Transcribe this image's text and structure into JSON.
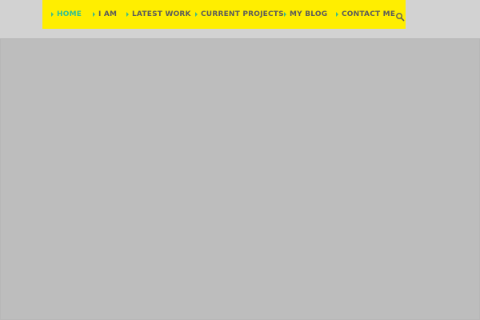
{
  "nav": {
    "items": [
      {
        "label": "HOME"
      },
      {
        "label": "I AM"
      },
      {
        "label": "LATEST WORK"
      },
      {
        "label": "CURRENT PROJECTS"
      },
      {
        "label": "MY BLOG"
      },
      {
        "label": "CONTACT ME"
      }
    ]
  },
  "icons": {
    "search": "search-icon",
    "arrow": "arrow-right-icon"
  },
  "colors": {
    "nav_background": "#ffee00",
    "active_text": "#2fbf95",
    "nav_text": "#5b5b5b",
    "arrow": "#3bbd8a",
    "page_background": "#bdbdbd",
    "topbar": "#d2d2d2"
  }
}
